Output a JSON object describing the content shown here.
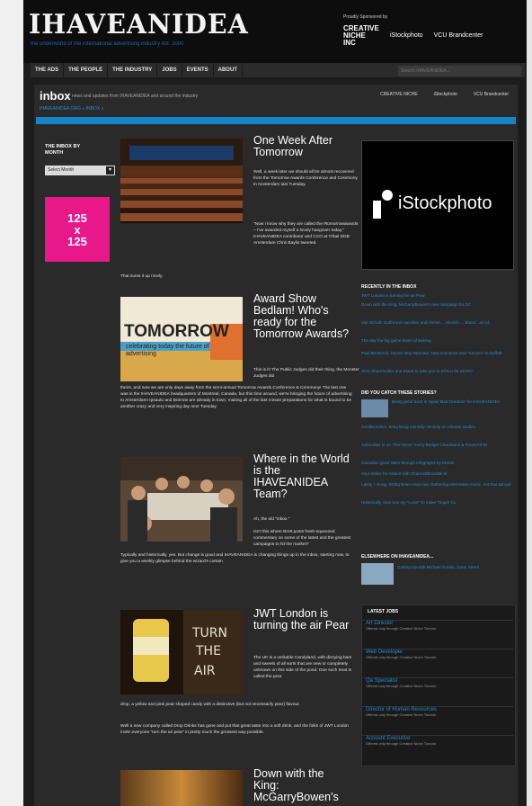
{
  "header": {
    "logo": "IHAVEANIDEA",
    "tagline": "the underworld of the international advertising industry est. 2000",
    "sponsor_caption": "Proudly Sponsored by",
    "sponsors": [
      "CREATIVE NICHE INC",
      "iStockphoto",
      "VCU Brandcenter"
    ]
  },
  "nav": {
    "items": [
      "THE ADS",
      "THE PEOPLE",
      "THE INDUSTRY",
      "JOBS",
      "EVENTS",
      "ABOUT"
    ],
    "search_placeholder": "Search IHAVEANIDEA..."
  },
  "inbox": {
    "title": "inbox",
    "subtitle": "news and updates from IHAVEANIDEA and around the industry",
    "sponsors": [
      "CREATIVE NICHE",
      "iStockphoto",
      "VCU Brandcenter"
    ],
    "breadcrumb": "IHAVEANIDEA.ORG » INBOX »"
  },
  "sidebar": {
    "heading": "THE INBOX BY MONTH",
    "select_value": "Select Month",
    "ad_lines": [
      "125",
      "x",
      "125"
    ]
  },
  "posts": [
    {
      "title": "One Week After Tomorrow",
      "side_text": "Well, a week later we should all be almost recovered from the Tomorrow Awards Conference and Ceremony in Amsterdam last Tuesday.",
      "quote": "\"Now I know why they are called the #tomorrowawards – I've awarded myself a lovely hangover today.\" IHAVEANIDEA contributor and CCO at Tribal DDB Amsterdam Chris Baylis tweeted.",
      "body": "That sums it up nicely."
    },
    {
      "title": "Award Show Bedlam! Who's ready for the Tomorrow Awards?",
      "side_text": "This is it! The Public Judges did their thing, the Monster Judges did",
      "body": "theirs, and now we are only days away from the semi-annual Tomorrow Awards Conference & Ceremony! The last one was in the IHAVEANIDEA headquarters of Montreal, Canada, but this time around, we're bringing the future of advertising to Amsterdam! Ipsauto and Brienne are already in town, making all of the last minute preparations for what is bound to be another crazy and very inspiring day next Tuesday.",
      "thumb_word": "TOMORROW",
      "thumb_sub": "celebrating today the future of advertising"
    },
    {
      "title": "Where in the World is the IHAVEANIDEA Team?",
      "side_text": "Ah, the old \"inbox.\"",
      "quote": "Isn't this where Brett posts fresh-squeezed commentary on some of the latest and the greatest campaigns to hit the market?",
      "body": "Typically and historically, yes. But change is good and IHAVEANIDEA is changing things up in the inbox, starting now, to give you a weekly glimpse behind the wizard's curtain."
    },
    {
      "title": "JWT London is turning the air Pear",
      "side_text": "The UK is a veritable Candyland, with dizzying bars and sweets of all sorts that are new or completely unknown on this side of the pond. One such treat is called the pear",
      "body": "drop, a yellow and pink pear shaped candy with a distinctive (but not necessarily pear) flavour.",
      "body2": "Well a new company called Drop Drinks has gone and put that great taste into a soft drink, and the folks of JWT London invite everyone \"turn the air pear\" in pretty much the grossest way possible."
    },
    {
      "title": "Down with the King: McGarryBowen's"
    }
  ],
  "right": {
    "ad_word": "iStockphoto",
    "recent_title": "RECENTLY IN THE INBOX",
    "recent": [
      "JWT London is turning the air Pear",
      "Down with the King: McGarryBowen's new campaign for DC",
      "Van Schaft: Gutfreund Hunziker and Ahmet ... Munich ... Brand.. art of..",
      "The day the big game down of Nalong",
      "Paul Benbrook, Sound Very Talented. New scenarios and \"Ancient\" to Suffolk",
      "SCG Shareholder and Stand to take you to STILL! for MARO"
    ],
    "catch_title": "DID YOU CATCH THESE STORIES?",
    "catch": [
      "Being great back in Spain Mad Creators' for IHAVEANIDEA",
      "GoodEmotion: bring living mentally minority on release studies",
      "Advocates in on \"The Show\" every Bridget Chandwick & PowerArt Br",
      "Canadian good sales through infographs by ENGE",
      "Your online for Asians with Channel/Brandsk 8/",
      "Lately I: Kong, hitting Brian Heat now Gathering Alternative music, not that abroad",
      "Historically case one my \"Luzer\" to make \"Super Cu"
    ],
    "elsewhere_title": "ELSEWHERE ON IHAVEANIDEA...",
    "elsewhere": "Getting Up with Michael Gordie, Goon Street",
    "jobs_title": "LATEST JOBS",
    "jobs": [
      {
        "title": "Art Director",
        "sub": "Offered only through Creative Niche Toronto"
      },
      {
        "title": "Web Developer",
        "sub": "Offered only through Creative Niche Toronto"
      },
      {
        "title": "Qa Specialist",
        "sub": "Offered only through Creative Niche Toronto"
      },
      {
        "title": "Director of Human Resources",
        "sub": "Offered only through Creative Niche Toronto"
      },
      {
        "title": "Account Executive",
        "sub": "Offered only through Creative Niche Toronto"
      }
    ]
  }
}
